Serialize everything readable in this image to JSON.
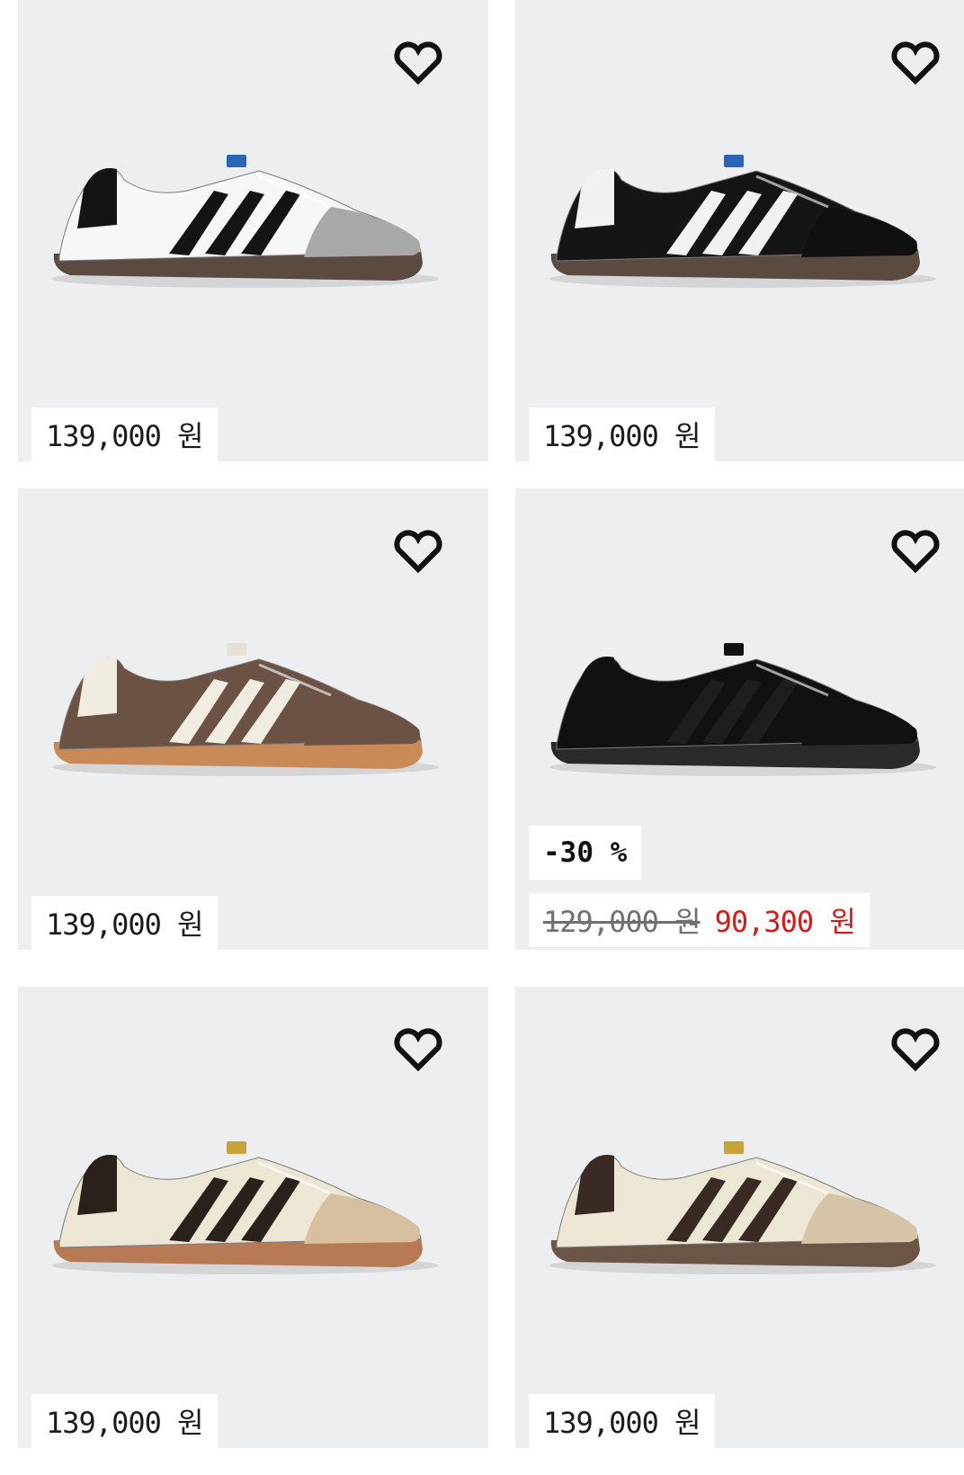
{
  "products": [
    {
      "price": "139,000 원",
      "shoe": {
        "upper": "#f7f7f7",
        "stripes": "#141414",
        "sole": "#5a4a40",
        "heel": "#141414",
        "toe": "#a8a8a8",
        "tag": "#2a66b8"
      },
      "wishlist_icon": "heart-icon"
    },
    {
      "price": "139,000 원",
      "shoe": {
        "upper": "#151515",
        "stripes": "#f1f1f1",
        "sole": "#5a4a40",
        "heel": "#f1f1f1",
        "toe": "#101010",
        "tag": "#2a66b8"
      },
      "wishlist_icon": "heart-icon"
    },
    {
      "price": "139,000 원",
      "shoe": {
        "upper": "#6c5245",
        "stripes": "#f0ece2",
        "sole": "#c98a58",
        "heel": "#f0ece2",
        "toe": "#6c5245",
        "tag": "#e7e0d4"
      },
      "wishlist_icon": "heart-icon"
    },
    {
      "discount": "-30 %",
      "original_price": "129,000 원",
      "sale_price": "90,300 원",
      "shoe": {
        "upper": "#111111",
        "stripes": "#1e1e1e",
        "sole": "#2a2a2a",
        "heel": "#111111",
        "toe": "#111111",
        "tag": "#111111"
      },
      "wishlist_icon": "heart-icon"
    },
    {
      "price": "139,000 원",
      "shoe": {
        "upper": "#ece6d5",
        "stripes": "#2a201c",
        "sole": "#b87a55",
        "heel": "#2a201c",
        "toe": "#d8bfa0",
        "tag": "#c9a33a"
      },
      "wishlist_icon": "heart-icon"
    },
    {
      "price": "139,000 원",
      "shoe": {
        "upper": "#ece6d5",
        "stripes": "#3a2a24",
        "sole": "#6a5546",
        "heel": "#3a2a24",
        "toe": "#d6c4a8",
        "tag": "#c9a33a"
      },
      "wishlist_icon": "heart-icon"
    }
  ],
  "colors": {
    "card_bg": "#eceeef",
    "sale_red": "#d21a1a",
    "text": "#1b1b1b"
  }
}
